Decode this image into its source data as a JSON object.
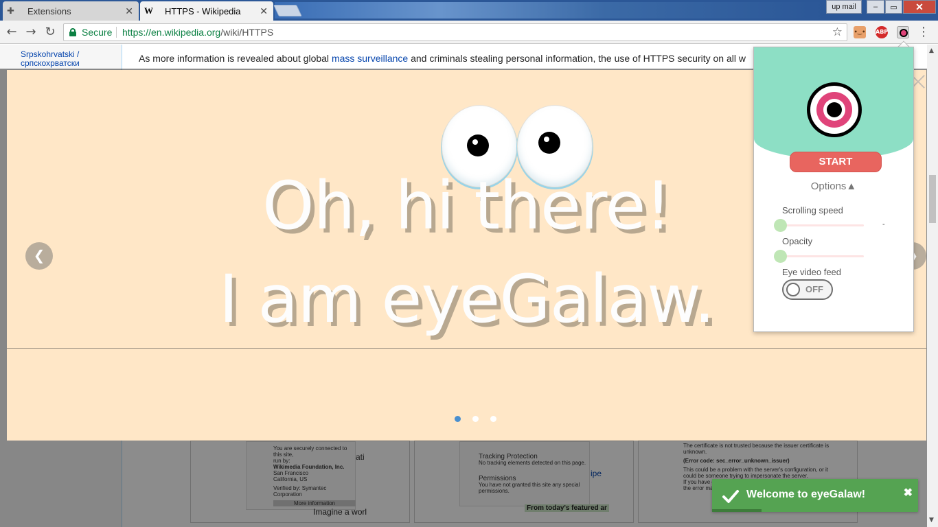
{
  "tabs": [
    {
      "title": "Extensions",
      "icon": "puzzle-icon",
      "active": false
    },
    {
      "title": "HTTPS - Wikipedia",
      "icon": "wikipedia-w-icon",
      "active": true
    }
  ],
  "window_controls": {
    "user_label": "up mail",
    "minimize": "–",
    "maximize": "▭",
    "close": "✕"
  },
  "toolbar": {
    "secure_label": "Secure",
    "url_origin": "https://en.wikipedia.org",
    "url_path": "/wiki/HTTPS",
    "extensions": [
      {
        "name": "extension-face-icon",
        "label": "",
        "color": "#e8a06a"
      },
      {
        "name": "abp-icon",
        "label": "ABP",
        "color": "#d42a2a"
      },
      {
        "name": "eyegalaw-icon",
        "label": "",
        "color": "#e0447a"
      }
    ]
  },
  "page": {
    "sidebar_link": "Srpskohrvatski / српскохрватски",
    "paragraph_pre": "As more information is revealed about global ",
    "paragraph_link": "mass surveillance",
    "paragraph_post": " and criminals stealing personal information, the use of HTTPS security on all w",
    "thumbs": [
      {
        "lines": [
          "You are securely connected to this site,",
          "run by:",
          "Wikimedia Foundation, Inc.",
          "San Francisco",
          "California, US",
          "Verified by: Symantec Corporation",
          "More information"
        ],
        "caption": "Imagine a worl",
        "extra": "ati"
      },
      {
        "lines": [
          "Tracking Protection",
          "No tracking elements detected on this page.",
          "Permissions",
          "You have not granted this site any special",
          "permissions."
        ],
        "caption": "From today's featured ar",
        "extra": "ipe"
      },
      {
        "lines": [
          "The certificate is not trusted because the issuer certificate is unknown.",
          "(Error code: sec_error_unknown_issuer)",
          "This could be a problem with the server's configuration, or it could be someone trying to impersonate the server.",
          "If you have connected to this server successfully in the past, the error may be temporary"
        ],
        "caption": "",
        "extra": ""
      }
    ]
  },
  "overlay": {
    "line1": "Oh, hi there!",
    "line2": "I am eyeGalaw.",
    "prev_label": "❮",
    "next_label": "❯",
    "slide_count": 3,
    "active_slide": 1
  },
  "popup": {
    "start_label": "START",
    "options_label": "Options▲",
    "scroll_speed_label": "Scrolling speed",
    "scroll_speed_value": 0,
    "scroll_speed_readout": "-",
    "opacity_label": "Opacity",
    "opacity_value": 0,
    "eye_feed_label": "Eye video feed",
    "eye_feed_state": "OFF"
  },
  "toast": {
    "message": "Welcome to eyeGalaw!",
    "close_label": "✖",
    "progress_fraction": 0.24
  }
}
